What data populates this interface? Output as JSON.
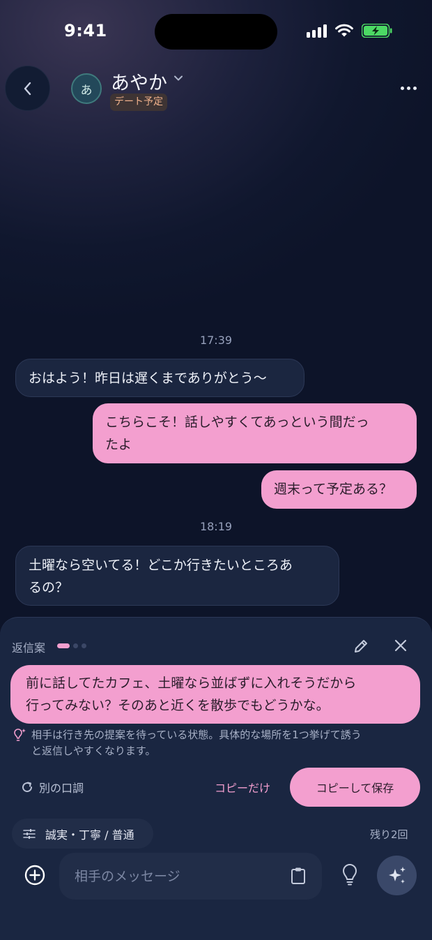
{
  "status_bar": {
    "time": "9:41"
  },
  "header": {
    "avatar_initial": "あ",
    "contact_name": "あやか",
    "status_tag": "デート予定"
  },
  "messages": [
    {
      "type": "timestamp",
      "text": "17:39"
    },
    {
      "type": "incoming",
      "text": "おはよう！昨日は遅くまでありがとう〜"
    },
    {
      "type": "outgoing",
      "lines": [
        "こちらこそ！話しやすくてあっという間だっ",
        "たよ"
      ]
    },
    {
      "type": "outgoing",
      "text": "週末って予定ある？"
    },
    {
      "type": "timestamp",
      "text": "18:19"
    },
    {
      "type": "incoming",
      "lines": [
        "土曜なら空いてる！どこか行きたいところあ",
        "るの？"
      ]
    }
  ],
  "suggestion_panel": {
    "label": "返信案",
    "suggestion_lines": [
      "前に話してたカフェ、土曜なら並ばずに入れそうだから",
      "行ってみない？そのあと近くを散歩でもどうかな。"
    ],
    "hint_lines": [
      "相手は行き先の提案を待っている状態。具体的な場所を1つ挙げて誘う",
      "と返信しやすくなります。"
    ],
    "alt_tone_label": "別の口調",
    "copy_only_label": "コピーだけ",
    "copy_save_label": "コピーして保存",
    "tone_label": "誠実・丁寧 / 普通",
    "remaining_label": "残り2回",
    "page_count": 3,
    "active_page": 1
  },
  "composer": {
    "placeholder": "相手のメッセージ"
  },
  "colors": {
    "accent_pink": "#f39fcf",
    "incoming_bubble": "#1b2640",
    "background": "#0d1429",
    "battery_green": "#4cd964",
    "tag_text": "#f1b28c"
  },
  "icons": [
    "back-chevron-icon",
    "chevron-down-icon",
    "more-icon",
    "pencil-icon",
    "close-icon",
    "lightbulb-sparkle-icon",
    "refresh-icon",
    "sliders-icon",
    "plus-circle-icon",
    "clipboard-icon",
    "lightbulb-icon",
    "sparkles-icon"
  ]
}
